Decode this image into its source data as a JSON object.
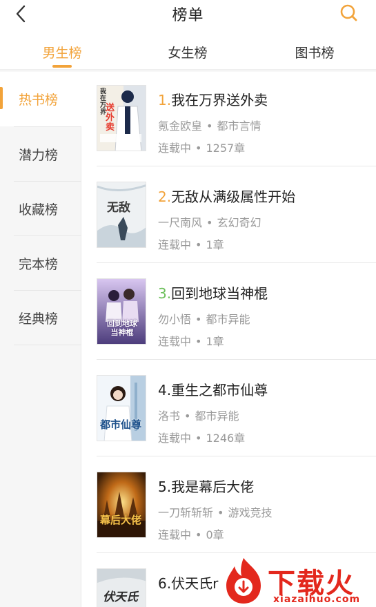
{
  "header": {
    "title": "榜单",
    "back_icon": "chevron-left-icon",
    "search_icon": "search-icon",
    "accent_color": "#f2a33a"
  },
  "tabs": [
    {
      "label": "男生榜",
      "active": true
    },
    {
      "label": "女生榜",
      "active": false
    },
    {
      "label": "图书榜",
      "active": false
    }
  ],
  "sidebar": {
    "items": [
      {
        "label": "热书榜",
        "active": true
      },
      {
        "label": "潜力榜",
        "active": false
      },
      {
        "label": "收藏榜",
        "active": false
      },
      {
        "label": "完本榜",
        "active": false
      },
      {
        "label": "经典榜",
        "active": false
      }
    ]
  },
  "books": [
    {
      "rank": "1.",
      "rank_color": "#f2a33a",
      "title": "我在万界送外卖",
      "author": "氪金欧皇",
      "genre": "都市言情",
      "status": "连载中",
      "chapters": "1257章",
      "cover": {
        "text": "送外卖",
        "small_text": "我在万界",
        "palette": [
          "#f3efe6",
          "#1c2a4a",
          "#e63b2e"
        ]
      }
    },
    {
      "rank": "2.",
      "rank_color": "#f2a33a",
      "title": "无敌从满级属性开始",
      "author": "一尺南风",
      "genre": "玄幻奇幻",
      "status": "连载中",
      "chapters": "1章",
      "cover": {
        "text": "无敌",
        "small_text": "",
        "palette": [
          "#eef1f3",
          "#3a4a5a",
          "#8aa3b8"
        ]
      }
    },
    {
      "rank": "3.",
      "rank_color": "#6cbf5a",
      "title": "回到地球当神棍",
      "author": "勿小悟",
      "genre": "都市异能",
      "status": "连载中",
      "chapters": "1章",
      "cover": {
        "text": "回到地球当神棍",
        "small_text": "",
        "palette": [
          "#5a4a8a",
          "#ffffff",
          "#d8c6f0"
        ]
      }
    },
    {
      "rank": "4.",
      "rank_color": "#222222",
      "title": "重生之都市仙尊",
      "author": "洛书",
      "genre": "都市异能",
      "status": "连载中",
      "chapters": "1246章",
      "cover": {
        "text": "都市仙尊",
        "small_text": "",
        "palette": [
          "#cfe3f2",
          "#1b4f8a",
          "#f2f6fa"
        ]
      }
    },
    {
      "rank": "5.",
      "rank_color": "#222222",
      "title": "我是幕后大佬",
      "author": "一刀斩斩斩",
      "genre": "游戏竞技",
      "status": "连载中",
      "chapters": "0章",
      "cover": {
        "text": "幕后大佬",
        "small_text": "",
        "palette": [
          "#8a4a12",
          "#f6c24a",
          "#3a1e08"
        ]
      }
    },
    {
      "rank": "6.",
      "rank_color": "#222222",
      "title": "伏天氏",
      "title_visible": "伏天氏r",
      "author": "",
      "genre": "",
      "status": "",
      "chapters": "",
      "cover": {
        "text": "伏天氏",
        "small_text": "",
        "palette": [
          "#e9ecee",
          "#2a2a2a",
          "#b8c0c6"
        ]
      }
    }
  ],
  "watermark": {
    "name": "下载火",
    "url": "xiazaihuo.com",
    "color": "#e3281d"
  }
}
